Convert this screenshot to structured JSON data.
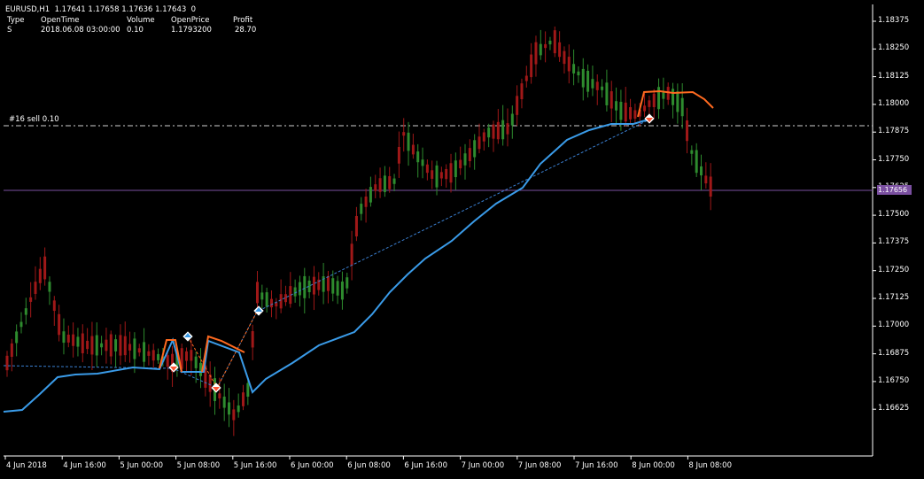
{
  "header": {
    "symbol_line": "EURUSD,H1  1.17641 1.17658 1.17636 1.17643  0",
    "columns": [
      "Type",
      "OpenTime",
      "Volume",
      "OpenPrice",
      "Profit"
    ],
    "row": [
      "S",
      "2018.06.08 03:00:00",
      "0.10",
      "1.1793200",
      "28.70"
    ]
  },
  "order_line_label": "#16 sell 0.10",
  "current_price_tag": "1.17656",
  "y_axis_labels": [
    "1.18375",
    "1.18250",
    "1.18125",
    "1.18000",
    "1.17875",
    "1.17750",
    "1.17625",
    "1.17500",
    "1.17375",
    "1.17250",
    "1.17125",
    "1.17000",
    "1.16875",
    "1.16750",
    "1.16625"
  ],
  "x_axis_labels": [
    "4 Jun 2018",
    "4 Jun 16:00",
    "5 Jun 00:00",
    "5 Jun 08:00",
    "5 Jun 16:00",
    "6 Jun 00:00",
    "6 Jun 08:00",
    "6 Jun 16:00",
    "7 Jun 00:00",
    "7 Jun 08:00",
    "7 Jun 16:00",
    "8 Jun 00:00",
    "8 Jun 08:00"
  ],
  "colors": {
    "background": "#000000",
    "bull_candle": "#2e8b2e",
    "bear_candle": "#a01818",
    "ma_line": "#3a9be8",
    "stop_line": "#ff6a20",
    "grid": "#2a2a2a",
    "order_line": "#d0d0d0",
    "trend_line": "#3a7fd0",
    "price_line": "#7a4fa0"
  },
  "icons": [
    "buy-arrow-icon",
    "sell-arrow-icon"
  ]
}
